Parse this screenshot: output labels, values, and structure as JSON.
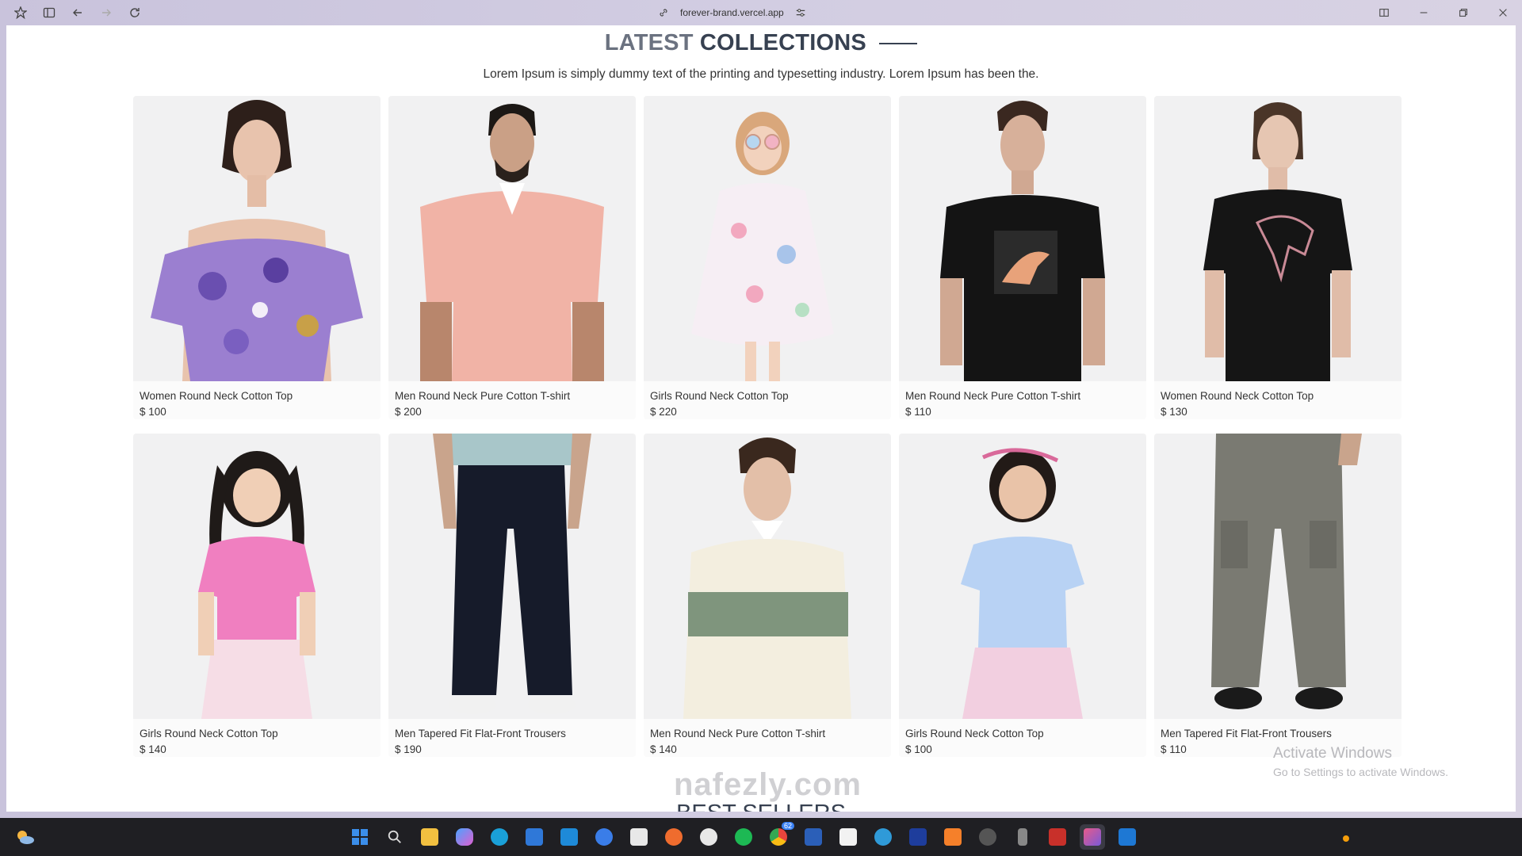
{
  "browser": {
    "url": "forever-brand.vercel.app"
  },
  "section": {
    "title_part1": "LATEST",
    "title_part2": "COLLECTIONS",
    "subtitle": "Lorem Ipsum is simply dummy text of the printing and typesetting industry. Lorem Ipsum has been the."
  },
  "products": [
    {
      "name": "Women Round Neck Cotton Top",
      "price": "$ 100"
    },
    {
      "name": "Men Round Neck Pure Cotton T-shirt",
      "price": "$ 200"
    },
    {
      "name": "Girls Round Neck Cotton Top",
      "price": "$ 220"
    },
    {
      "name": "Men Round Neck Pure Cotton T-shirt",
      "price": "$ 110"
    },
    {
      "name": "Women Round Neck Cotton Top",
      "price": "$ 130"
    },
    {
      "name": "Girls Round Neck Cotton Top",
      "price": "$ 140"
    },
    {
      "name": "Men Tapered Fit Flat-Front Trousers",
      "price": "$ 190"
    },
    {
      "name": "Men Round Neck Pure Cotton T-shirt",
      "price": "$ 140"
    },
    {
      "name": "Girls Round Neck Cotton Top",
      "price": "$ 100"
    },
    {
      "name": "Men Tapered Fit Flat-Front Trousers",
      "price": "$ 110"
    }
  ],
  "next_section": {
    "title": "BEST SELLERS"
  },
  "watermarks": {
    "activate": "Activate Windows",
    "activate_sub": "Go to Settings to activate Windows.",
    "site": "nafezly.com"
  },
  "taskbar": {
    "badge_count": "62"
  }
}
